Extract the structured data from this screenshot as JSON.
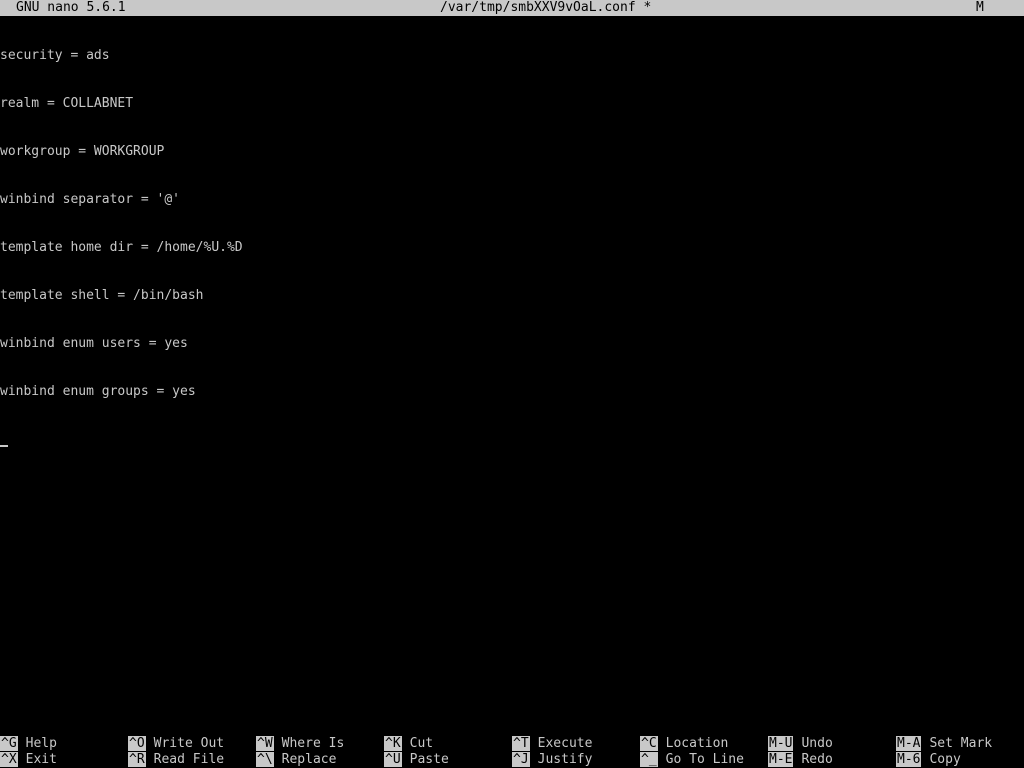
{
  "titlebar": {
    "version": "GNU nano 5.6.1",
    "filename": "/var/tmp/smbXXV9vOaL.conf *",
    "modified_flag": "M"
  },
  "editor": {
    "lines": [
      "security = ads",
      "realm = COLLABNET",
      "workgroup = WORKGROUP",
      "winbind separator = '@'",
      "template home dir = /home/%U.%D",
      "template shell = /bin/bash",
      "winbind enum users = yes",
      "winbind enum groups = yes"
    ]
  },
  "shortcuts": {
    "row1": [
      {
        "key": "^G",
        "label": "Help"
      },
      {
        "key": "^O",
        "label": "Write Out"
      },
      {
        "key": "^W",
        "label": "Where Is"
      },
      {
        "key": "^K",
        "label": "Cut"
      },
      {
        "key": "^T",
        "label": "Execute"
      },
      {
        "key": "^C",
        "label": "Location"
      },
      {
        "key": "M-U",
        "label": "Undo"
      },
      {
        "key": "M-A",
        "label": "Set Mark"
      }
    ],
    "row2": [
      {
        "key": "^X",
        "label": "Exit"
      },
      {
        "key": "^R",
        "label": "Read File"
      },
      {
        "key": "^\\",
        "label": "Replace"
      },
      {
        "key": "^U",
        "label": "Paste"
      },
      {
        "key": "^J",
        "label": "Justify"
      },
      {
        "key": "^_",
        "label": "Go To Line"
      },
      {
        "key": "M-E",
        "label": "Redo"
      },
      {
        "key": "M-6",
        "label": "Copy"
      }
    ]
  }
}
